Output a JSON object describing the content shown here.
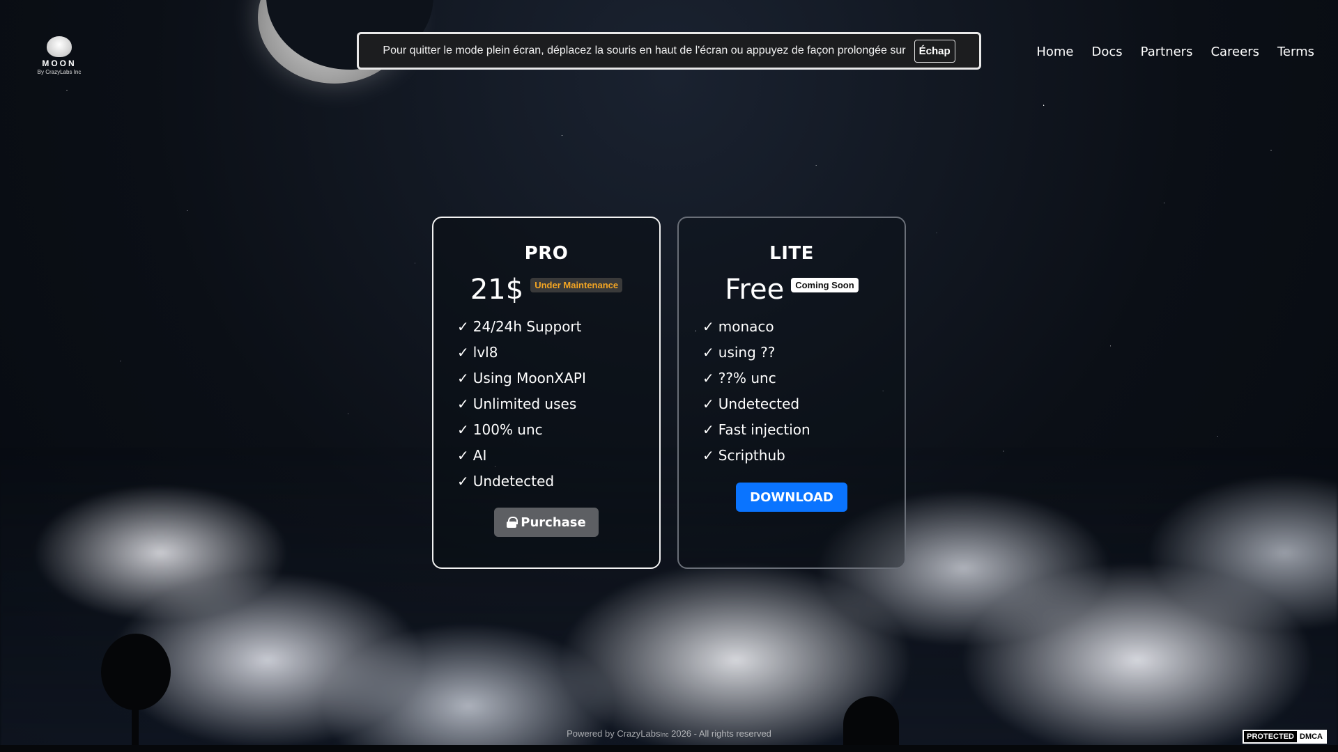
{
  "logo": {
    "title": "MOON",
    "subtitle": "By CrazyLabs Inc"
  },
  "banner": {
    "text": "Pour quitter le mode plein écran, déplacez la souris en haut de l'écran ou appuyez de façon prolongée sur",
    "key": "Échap"
  },
  "nav": [
    "Home",
    "Docs",
    "Partners",
    "Careers",
    "Terms"
  ],
  "plans": {
    "pro": {
      "name": "PRO",
      "price": "21$",
      "badge": "Under Maintenance",
      "features": [
        "24/24h Support",
        "lvl8",
        "Using MoonXAPI",
        "Unlimited uses",
        "100% unc",
        "AI",
        "Undetected"
      ],
      "button": "Purchase",
      "button_icon": "lock-icon"
    },
    "lite": {
      "name": "LITE",
      "price": "Free",
      "badge": "Coming Soon",
      "features": [
        "monaco",
        "using ??",
        "??% unc",
        "Undetected",
        "Fast injection",
        "Scripthub"
      ],
      "button": "DOWNLOAD"
    }
  },
  "footer": {
    "prefix": "Powered by ",
    "brand": "CrazyLabs",
    "brand_suffix": "Inc",
    "rest": " 2026 - All rights reserved"
  },
  "dmca": {
    "left": "PROTECTED",
    "right": "DMCA"
  },
  "colors": {
    "accent_blue": "#0a74ff",
    "maintenance": "#f5a623",
    "disabled_button": "#5d5f63"
  }
}
